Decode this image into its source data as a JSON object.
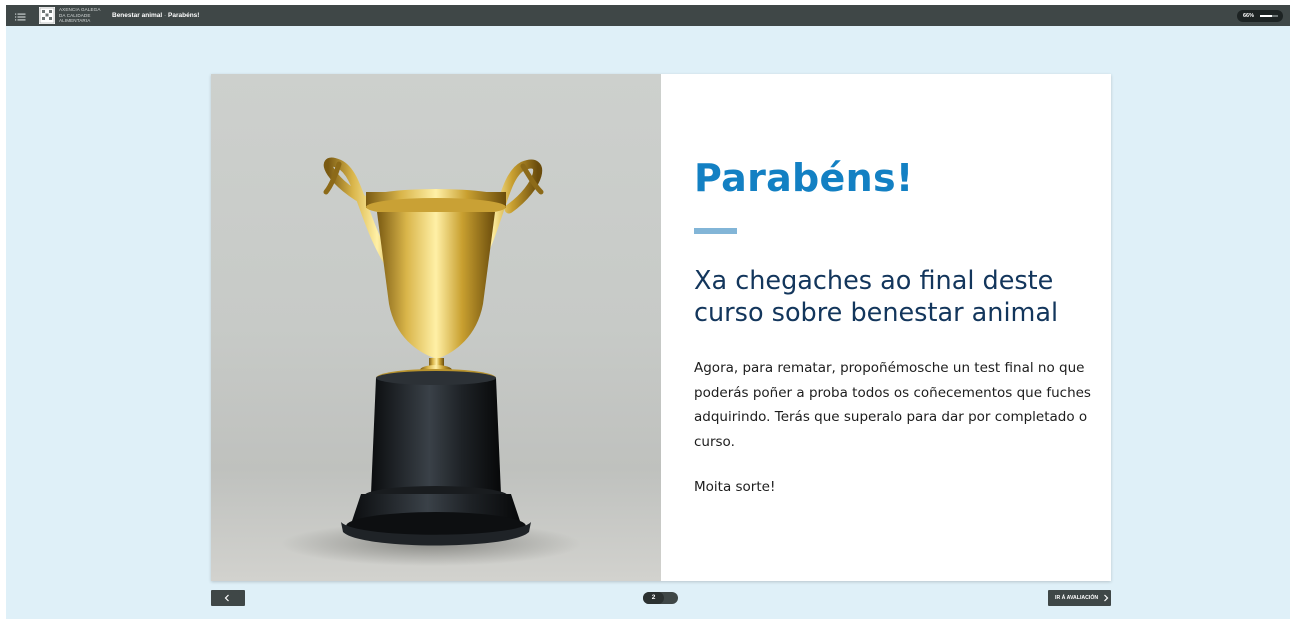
{
  "header": {
    "logo_lines": [
      "AXENCIA GALEGA",
      "DA CALIDADE",
      "ALIMENTARIA"
    ],
    "course_name": "Benestar animal",
    "separator": "·",
    "current_lesson": "Parabéns!",
    "progress_label": "66%",
    "progress_value": 0.66
  },
  "main": {
    "image_icon": "trophy-image",
    "heading": "Parabéns!",
    "subheading": "Xa chegaches ao final deste curso sobre benestar animal",
    "body": "Agora, para rematar, propoñémosche un test final no que poderás poñer a proba todos os coñecementos que fuches adquirindo. Terás que superalo para dar por completado o curso.",
    "signoff": "Moita sorte!"
  },
  "footer": {
    "page_number": "2",
    "next_label": "IR Á AVALIACIÓN"
  },
  "colors": {
    "topbar": "#3f4747",
    "background": "#dff0f8",
    "heading": "#1380c3",
    "divider": "#82b5d7",
    "subheading": "#13365c"
  }
}
